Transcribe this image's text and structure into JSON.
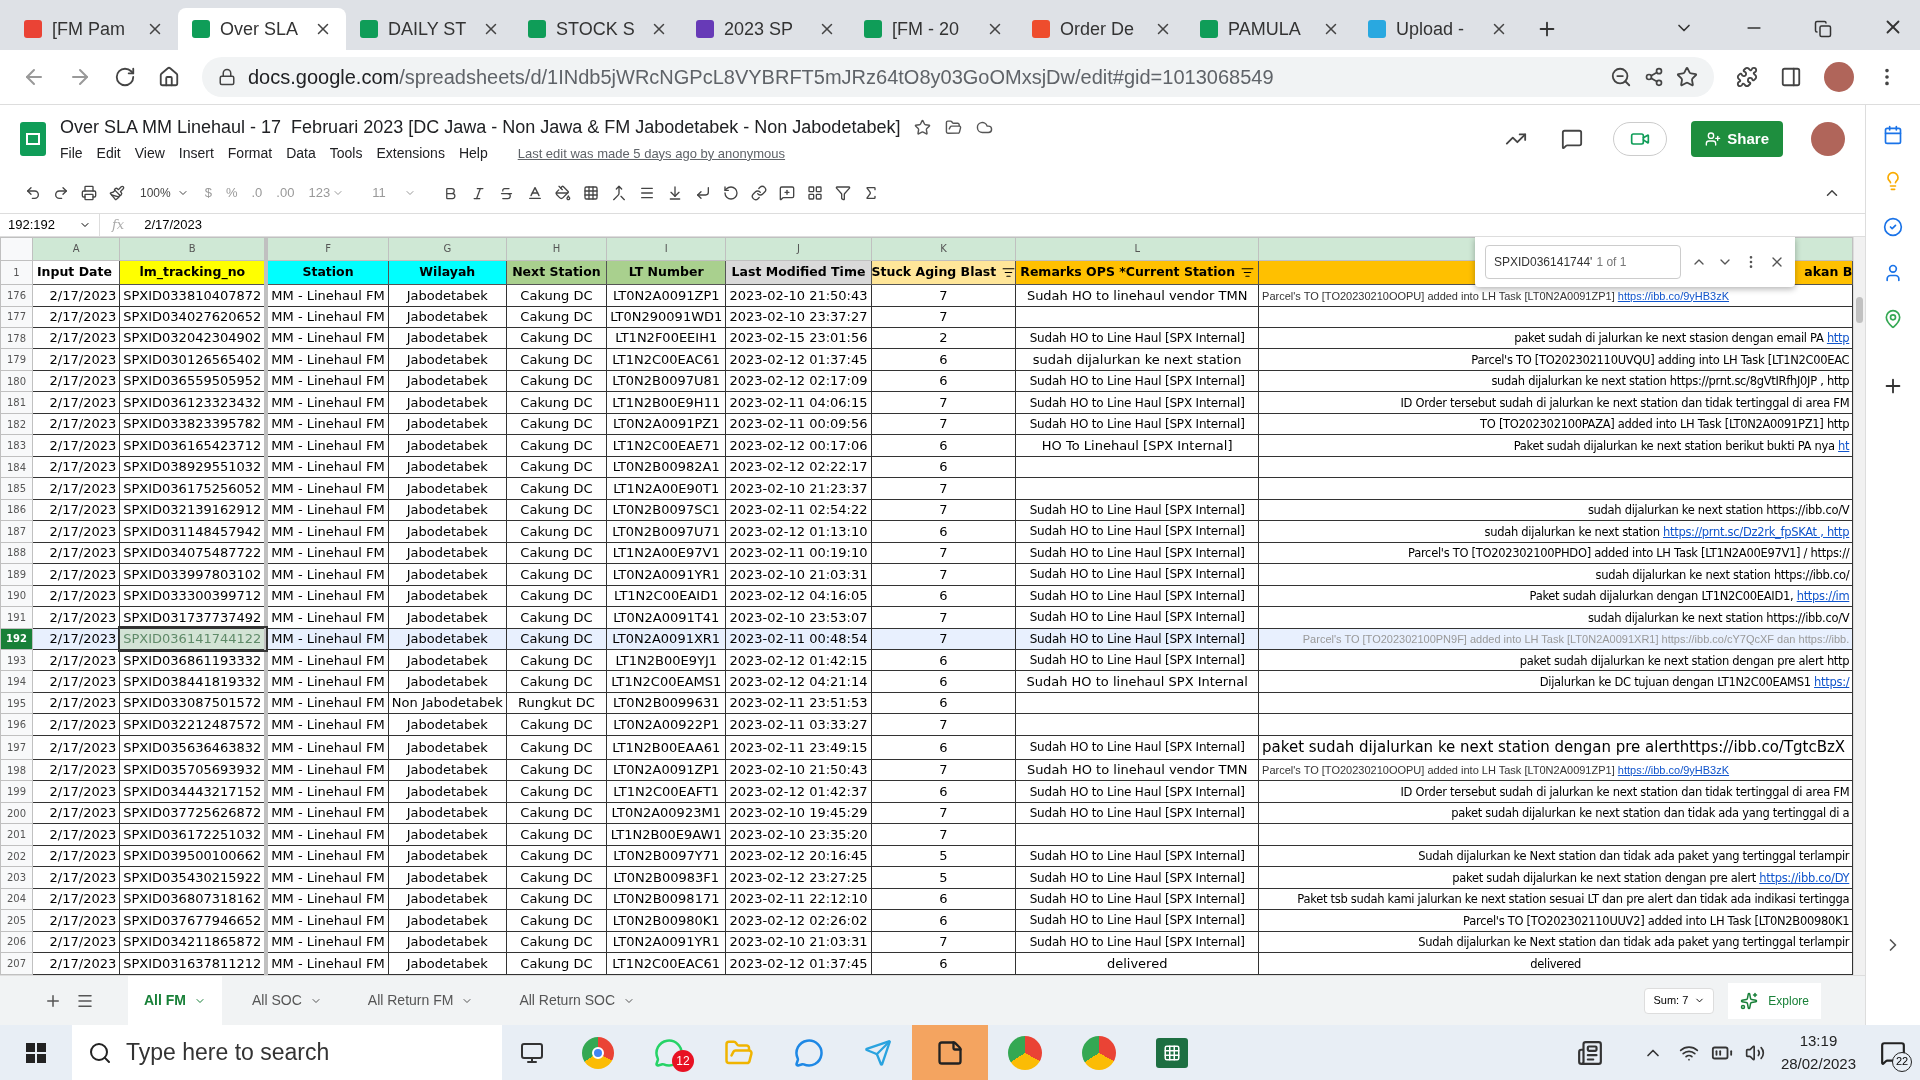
{
  "browser": {
    "tabs": [
      {
        "label": "[FM Pam",
        "kind": "mail",
        "selected": false
      },
      {
        "label": "Over SLA",
        "kind": "sheet",
        "selected": true
      },
      {
        "label": "DAILY ST",
        "kind": "sheet",
        "selected": false
      },
      {
        "label": "STOCK S",
        "kind": "sheet",
        "selected": false
      },
      {
        "label": "2023 SP",
        "kind": "form",
        "selected": false
      },
      {
        "label": "[FM - 20",
        "kind": "sheet",
        "selected": false
      },
      {
        "label": "Order De",
        "kind": "shop",
        "selected": false
      },
      {
        "label": "PAMULA",
        "kind": "sheet",
        "selected": false
      },
      {
        "label": "Upload -",
        "kind": "upload",
        "selected": false
      }
    ],
    "address": {
      "host": "docs.google.com",
      "path": "/spreadsheets/d/1INdb5jWRcNGPcL8VYBRFT5mJRz64tO8y03GoOMxsjDw/edit#gid=1013068549"
    }
  },
  "document": {
    "title": "Over SLA MM Linehaul - 17  Februari 2023 [DC Jawa - Non Jawa & FM Jabodetabek - Non Jabodetabek]",
    "menus": [
      "File",
      "Edit",
      "View",
      "Insert",
      "Format",
      "Data",
      "Tools",
      "Extensions",
      "Help"
    ],
    "last_edit": "Last edit was made 5 days ago by anonymous",
    "share": "Share"
  },
  "toolbar": {
    "zoom": "100%",
    "currency": "$",
    "percent": "%",
    "decrease_decimals": ".0",
    "increase_decimals": ".00",
    "number_format": "123",
    "font_size": "11"
  },
  "formula_bar": {
    "name_box": "192:192",
    "fx": "fx",
    "value": "2/17/2023"
  },
  "find_bar": {
    "query": "SPXID036141744'",
    "count": "1 of 1"
  },
  "sheet": {
    "column_letters": [
      "A",
      "B",
      "F",
      "G",
      "H",
      "I",
      "J",
      "K",
      "L"
    ],
    "header_row": "1",
    "headers": [
      {
        "label": "Input Date",
        "color": "#ffffff",
        "filter": false
      },
      {
        "label": "lm_tracking_no",
        "color": "#ffff00",
        "filter": false
      },
      {
        "label": "Station",
        "color": "#00ffff",
        "filter": false
      },
      {
        "label": "Wilayah",
        "color": "#00ffff",
        "filter": false
      },
      {
        "label": "Next Station",
        "color": "#a9d08e",
        "filter": false
      },
      {
        "label": "LT Number",
        "color": "#a9d08e",
        "filter": false
      },
      {
        "label": "Last Modified Time",
        "color": "#d9d9d9",
        "filter": false
      },
      {
        "label": "Stuck Aging Blast",
        "color": "#ffe699",
        "filter": true
      },
      {
        "label": "Remarks OPS *Current Station",
        "color": "#ffc000",
        "filter": true
      },
      {
        "label": "akan B",
        "color": "#ffc000",
        "filter": false
      }
    ],
    "rows": [
      {
        "row": "176",
        "selected": false,
        "cells": [
          "2/17/2023",
          "SPXID033810407872",
          "MM - Linehaul FM",
          "Jabodetabek",
          "Cakung DC",
          "LT0N2A0091ZP1",
          "2023-02-10 21:50:43",
          "7",
          "Sudah HO to linehaul vendor TMN"
        ],
        "note": {
          "kind": "small",
          "text": "Parcel's TO [TO20230210OOPU] added into LH Task [LT0N2A0091ZP1] ",
          "link": "https://ibb.co/9yHB3zK"
        }
      },
      {
        "row": "177",
        "selected": false,
        "cells": [
          "2/17/2023",
          "SPXID034027620652",
          "MM - Linehaul FM",
          "Jabodetabek",
          "Cakung DC",
          "LT0N290091WD1",
          "2023-02-10 23:37:27",
          "7"
        ]
      },
      {
        "row": "178",
        "selected": false,
        "cells": [
          "2/17/2023",
          "SPXID032042304902",
          "MM - Linehaul FM",
          "Jabodetabek",
          "Cakung DC",
          "LT1N2F00EEIH1",
          "2023-02-15 23:01:56",
          "2",
          "Sudah HO to Line Haul [SPX Internal]"
        ],
        "note": {
          "kind": "normal",
          "text": "paket sudah di jalurkan ke next stasion dengan email PA ",
          "link": "http"
        }
      },
      {
        "row": "179",
        "selected": false,
        "cells": [
          "2/17/2023",
          "SPXID030126565402",
          "MM - Linehaul FM",
          "Jabodetabek",
          "Cakung DC",
          "LT1N2C00EAC61",
          "2023-02-12 01:37:45",
          "6",
          "sudah dijalurkan ke next station"
        ],
        "note": {
          "kind": "normal",
          "text": "Parcel's TO [TO202302110UVQU] adding into LH Task [LT1N2C00EAC"
        }
      },
      {
        "row": "180",
        "selected": false,
        "cells": [
          "2/17/2023",
          "SPXID036559505952",
          "MM - Linehaul FM",
          "Jabodetabek",
          "Cakung DC",
          "LT0N2B0097U81",
          "2023-02-12 02:17:09",
          "6",
          "Sudah HO to Line Haul [SPX Internal]"
        ],
        "note": {
          "kind": "normal",
          "text": "sudah dijalurkan ke next station https://prnt.sc/8gVtIRfhJ0JP , http"
        }
      },
      {
        "row": "181",
        "selected": false,
        "cells": [
          "2/17/2023",
          "SPXID036123323432",
          "MM - Linehaul FM",
          "Jabodetabek",
          "Cakung DC",
          "LT1N2B00E9H11",
          "2023-02-11 04:06:15",
          "7",
          "Sudah HO to Line Haul [SPX Internal]"
        ],
        "note": {
          "kind": "normal",
          "text": "ID Order tersebut sudah di jalurkan ke next station dan tidak tertinggal di area FM"
        }
      },
      {
        "row": "182",
        "selected": false,
        "cells": [
          "2/17/2023",
          "SPXID033823395782",
          "MM - Linehaul FM",
          "Jabodetabek",
          "Cakung DC",
          "LT0N2A0091PZ1",
          "2023-02-11 00:09:56",
          "7",
          "Sudah HO to Line Haul [SPX Internal]"
        ],
        "note": {
          "kind": "normal",
          "text": "TO [TO202302100PAZA] added into LH Task [LT0N2A0091PZ1] http"
        }
      },
      {
        "row": "183",
        "selected": false,
        "cells": [
          "2/17/2023",
          "SPXID036165423712",
          "MM - Linehaul FM",
          "Jabodetabek",
          "Cakung DC",
          "LT1N2C00EAE71",
          "2023-02-12 00:17:06",
          "6",
          "HO To Linehaul [SPX Internal]"
        ],
        "note": {
          "kind": "normal",
          "text": "Paket sudah dijalurkan ke next station berikut bukti PA nya ",
          "link": "ht"
        }
      },
      {
        "row": "184",
        "selected": false,
        "cells": [
          "2/17/2023",
          "SPXID038929551032",
          "MM - Linehaul FM",
          "Jabodetabek",
          "Cakung DC",
          "LT0N2B00982A1",
          "2023-02-12 02:22:17",
          "6"
        ]
      },
      {
        "row": "185",
        "selected": false,
        "cells": [
          "2/17/2023",
          "SPXID036175256052",
          "MM - Linehaul FM",
          "Jabodetabek",
          "Cakung DC",
          "LT1N2A00E90T1",
          "2023-02-10 21:23:37",
          "7"
        ]
      },
      {
        "row": "186",
        "selected": false,
        "cells": [
          "2/17/2023",
          "SPXID032139162912",
          "MM - Linehaul FM",
          "Jabodetabek",
          "Cakung DC",
          "LT0N2B0097SC1",
          "2023-02-11 02:54:22",
          "7",
          "Sudah HO to Line Haul [SPX Internal]"
        ],
        "note": {
          "kind": "normal",
          "text": "sudah dijalurkan ke next station https://ibb.co/V"
        }
      },
      {
        "row": "187",
        "selected": false,
        "cells": [
          "2/17/2023",
          "SPXID031148457942",
          "MM - Linehaul FM",
          "Jabodetabek",
          "Cakung DC",
          "LT0N2B0097U71",
          "2023-02-12 01:13:10",
          "6",
          "Sudah HO to Line Haul [SPX Internal]"
        ],
        "note": {
          "kind": "normal",
          "text": "sudah dijalurkan ke next station ",
          "link": "https://prnt.sc/Dz2rk_fpSKAt , http"
        }
      },
      {
        "row": "188",
        "selected": false,
        "cells": [
          "2/17/2023",
          "SPXID034075487722",
          "MM - Linehaul FM",
          "Jabodetabek",
          "Cakung DC",
          "LT1N2A00E97V1",
          "2023-02-11 00:19:10",
          "7",
          "Sudah HO to Line Haul [SPX Internal]"
        ],
        "note": {
          "kind": "normal",
          "text": "Parcel's TO [TO202302100PHDO] added into LH Task [LT1N2A00E97V1] / https://"
        }
      },
      {
        "row": "189",
        "selected": false,
        "cells": [
          "2/17/2023",
          "SPXID033997803102",
          "MM - Linehaul FM",
          "Jabodetabek",
          "Cakung DC",
          "LT0N2A0091YR1",
          "2023-02-10 21:03:31",
          "7",
          "Sudah HO to Line Haul [SPX Internal]"
        ],
        "note": {
          "kind": "normal",
          "text": "sudah dijalurkan ke next station https://ibb.co/"
        }
      },
      {
        "row": "190",
        "selected": false,
        "cells": [
          "2/17/2023",
          "SPXID033300399712",
          "MM - Linehaul FM",
          "Jabodetabek",
          "Cakung DC",
          "LT1N2C00EAID1",
          "2023-02-12 04:16:05",
          "6",
          "Sudah HO to Line Haul [SPX Internal]"
        ],
        "note": {
          "kind": "normal",
          "text": "Paket sudah dijalurkan dengan LT1N2C00EAID1, ",
          "link": "https://im"
        }
      },
      {
        "row": "191",
        "selected": false,
        "cells": [
          "2/17/2023",
          "SPXID031737737492",
          "MM - Linehaul FM",
          "Jabodetabek",
          "Cakung DC",
          "LT0N2A0091T41",
          "2023-02-10 23:53:07",
          "7",
          "Sudah HO to Line Haul [SPX Internal]"
        ],
        "note": {
          "kind": "normal",
          "text": "sudah dijalurkan ke next station https://ibb.co/V"
        }
      },
      {
        "row": "192",
        "selected": true,
        "cells": [
          "2/17/2023",
          "SPXID036141744122",
          "MM - Linehaul FM",
          "Jabodetabek",
          "Cakung DC",
          "LT0N2A0091XR1",
          "2023-02-11 00:48:54",
          "7",
          "Sudah HO to Line Haul [SPX Internal]"
        ],
        "note": {
          "kind": "muted",
          "text": "Parcel's TO [TO202302100PN9F] added into LH Task [LT0N2A0091XR1] https://ibb.co/cY7QcXF dan https://ibb."
        }
      },
      {
        "row": "193",
        "selected": false,
        "cells": [
          "2/17/2023",
          "SPXID036861193332",
          "MM - Linehaul FM",
          "Jabodetabek",
          "Cakung DC",
          "LT1N2B00E9YJ1",
          "2023-02-12 01:42:15",
          "6",
          "Sudah HO to Line Haul [SPX Internal]"
        ],
        "note": {
          "kind": "normal",
          "text": "paket sudah dijalurkan ke next station dengan pre alert http"
        }
      },
      {
        "row": "194",
        "selected": false,
        "cells": [
          "2/17/2023",
          "SPXID038441819332",
          "MM - Linehaul FM",
          "Jabodetabek",
          "Cakung DC",
          "LT1N2C00EAMS1",
          "2023-02-12 04:21:14",
          "6",
          "Sudah HO to linehaul SPX Internal"
        ],
        "note": {
          "kind": "normal",
          "text": "Dijalurkan ke DC tujuan dengan LT1N2C00EAMS1 ",
          "link": "https:/"
        }
      },
      {
        "row": "195",
        "selected": false,
        "cells": [
          "2/17/2023",
          "SPXID033087501572",
          "MM - Linehaul FM",
          "Non Jabodetabek",
          "Rungkut DC",
          "LT0N2B0099631",
          "2023-02-11 23:51:53",
          "6"
        ]
      },
      {
        "row": "196",
        "selected": false,
        "cells": [
          "2/17/2023",
          "SPXID032212487572",
          "MM - Linehaul FM",
          "Jabodetabek",
          "Cakung DC",
          "LT0N2A00922P1",
          "2023-02-11 03:33:27",
          "7"
        ]
      },
      {
        "row": "197",
        "selected": false,
        "cells": [
          "2/17/2023",
          "SPXID035636463832",
          "MM - Linehaul FM",
          "Jabodetabek",
          "Cakung DC",
          "LT1N2B00EAA61",
          "2023-02-11 23:49:15",
          "6",
          "Sudah HO to Line Haul [SPX Internal]"
        ],
        "note": {
          "kind": "large",
          "text": "paket sudah dijalurkan ke next station dengan pre alerthttps://ibb.co/TgtcBzX"
        }
      },
      {
        "row": "198",
        "selected": false,
        "cells": [
          "2/17/2023",
          "SPXID035705693932",
          "MM - Linehaul FM",
          "Jabodetabek",
          "Cakung DC",
          "LT0N2A0091ZP1",
          "2023-02-10 21:50:43",
          "7",
          "Sudah HO to linehaul vendor TMN"
        ],
        "note": {
          "kind": "small",
          "text": "Parcel's TO [TO20230210OOPU] added into LH Task [LT0N2A0091ZP1] ",
          "link": "https://ibb.co/9yHB3zK"
        }
      },
      {
        "row": "199",
        "selected": false,
        "cells": [
          "2/17/2023",
          "SPXID034443217152",
          "MM - Linehaul FM",
          "Jabodetabek",
          "Cakung DC",
          "LT1N2C00EAFT1",
          "2023-02-12 01:42:37",
          "6",
          "Sudah HO to Line Haul [SPX Internal]"
        ],
        "note": {
          "kind": "normal",
          "text": "ID Order tersebut sudah di jalurkan ke next station dan tidak tertinggal di area FM"
        }
      },
      {
        "row": "200",
        "selected": false,
        "cells": [
          "2/17/2023",
          "SPXID037725626872",
          "MM - Linehaul FM",
          "Jabodetabek",
          "Cakung DC",
          "LT0N2A00923M1",
          "2023-02-10 19:45:29",
          "7",
          "Sudah HO to Line Haul [SPX Internal]"
        ],
        "note": {
          "kind": "normal",
          "text": "paket sudah dijalurkan ke next station dan tidak ada yang tertinggal di a"
        }
      },
      {
        "row": "201",
        "selected": false,
        "cells": [
          "2/17/2023",
          "SPXID036172251032",
          "MM - Linehaul FM",
          "Jabodetabek",
          "Cakung DC",
          "LT1N2B00E9AW1",
          "2023-02-10 23:35:20",
          "7"
        ]
      },
      {
        "row": "202",
        "selected": false,
        "cells": [
          "2/17/2023",
          "SPXID039500100662",
          "MM - Linehaul FM",
          "Jabodetabek",
          "Cakung DC",
          "LT0N2B0097Y71",
          "2023-02-12 20:16:45",
          "5",
          "Sudah HO to Line Haul [SPX Internal]"
        ],
        "note": {
          "kind": "normal",
          "text": "Sudah dijalurkan ke Next station dan tidak ada paket yang tertinggal terlampir"
        }
      },
      {
        "row": "203",
        "selected": false,
        "cells": [
          "2/17/2023",
          "SPXID035430215922",
          "MM - Linehaul FM",
          "Jabodetabek",
          "Cakung DC",
          "LT0N2B00983F1",
          "2023-02-12 23:27:25",
          "5",
          "Sudah HO to Line Haul [SPX Internal]"
        ],
        "note": {
          "kind": "normal",
          "text": "paket sudah dijalurkan ke next station dengan pre alert ",
          "link": "https://ibb.co/DY"
        }
      },
      {
        "row": "204",
        "selected": false,
        "cells": [
          "2/17/2023",
          "SPXID036807318162",
          "MM - Linehaul FM",
          "Jabodetabek",
          "Cakung DC",
          "LT0N2B0098171",
          "2023-02-11 22:12:10",
          "6",
          "Sudah HO to Line Haul [SPX Internal]"
        ],
        "note": {
          "kind": "normal",
          "text": "Paket tsb sudah kami jalurkan ke next station sesuai LT dan pre alert dan tidak ada indikasi tertingga"
        }
      },
      {
        "row": "205",
        "selected": false,
        "cells": [
          "2/17/2023",
          "SPXID037677946652",
          "MM - Linehaul FM",
          "Jabodetabek",
          "Cakung DC",
          "LT0N2B00980K1",
          "2023-02-12 02:26:02",
          "6",
          "Sudah HO to Line Haul [SPX Internal]"
        ],
        "note": {
          "kind": "normal",
          "text": "Parcel's TO [TO202302110UUV2] added into LH Task [LT0N2B00980K1"
        }
      },
      {
        "row": "206",
        "selected": false,
        "cells": [
          "2/17/2023",
          "SPXID034211865872",
          "MM - Linehaul FM",
          "Jabodetabek",
          "Cakung DC",
          "LT0N2A0091YR1",
          "2023-02-10 21:03:31",
          "7",
          "Sudah HO to Line Haul [SPX Internal]"
        ],
        "note": {
          "kind": "normal",
          "text": "Sudah dijalurkan ke Next station dan tidak ada paket yang tertinggal terlampir"
        }
      },
      {
        "row": "207",
        "selected": false,
        "cells": [
          "2/17/2023",
          "SPXID031637811212",
          "MM - Linehaul FM",
          "Jabodetabek",
          "Cakung DC",
          "LT1N2C00EAC61",
          "2023-02-12 01:37:45",
          "6",
          "delivered"
        ],
        "note": {
          "kind": "center",
          "text": "delivered"
        }
      }
    ]
  },
  "sheet_tabs": [
    {
      "label": "All FM",
      "selected": true
    },
    {
      "label": "All SOC",
      "selected": false
    },
    {
      "label": "All Return FM",
      "selected": false
    },
    {
      "label": "All Return SOC",
      "selected": false
    }
  ],
  "sum": "Sum: 7",
  "explore": "Explore",
  "taskbar": {
    "search_placeholder": "Type here to search",
    "whatsapp_badge": "12",
    "time": "13:19",
    "date": "28/02/2023",
    "notifications": "22"
  }
}
